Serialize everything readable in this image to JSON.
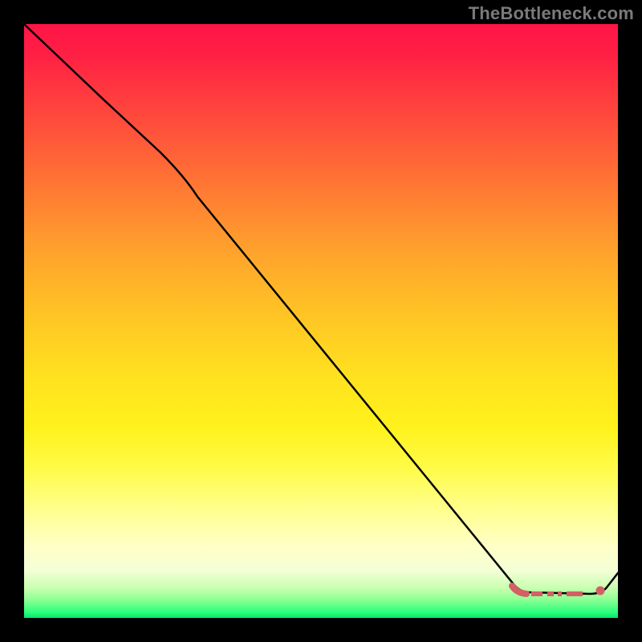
{
  "watermark": "TheBottleneck.com",
  "colors": {
    "curve": "#000000",
    "optimal_marker": "#d46065",
    "gradient_top": "#ff1547",
    "gradient_bottom": "#00e86b",
    "frame": "#000000"
  },
  "chart_data": {
    "type": "line",
    "title": "",
    "xlabel": "",
    "ylabel": "",
    "x_range": [
      0,
      100
    ],
    "y_range": [
      0,
      100
    ],
    "series": [
      {
        "name": "bottleneck_curve",
        "x": [
          0,
          14,
          23,
          29,
          82,
          85,
          95,
          97,
          100
        ],
        "y": [
          100,
          87,
          78,
          71,
          6,
          4,
          4,
          5,
          8
        ]
      }
    ],
    "optimal_range": {
      "x_start": 82,
      "x_end": 97,
      "y": 4
    },
    "optimal_point": {
      "x": 97,
      "y": 5
    },
    "annotations": [],
    "legend": false,
    "grid": false,
    "background_gradient": {
      "direction": "vertical",
      "stops": [
        {
          "pos": 0.0,
          "color": "#ff1547"
        },
        {
          "pos": 0.5,
          "color": "#ffcd23"
        },
        {
          "pos": 0.8,
          "color": "#ffff90"
        },
        {
          "pos": 1.0,
          "color": "#00e86b"
        }
      ]
    }
  }
}
